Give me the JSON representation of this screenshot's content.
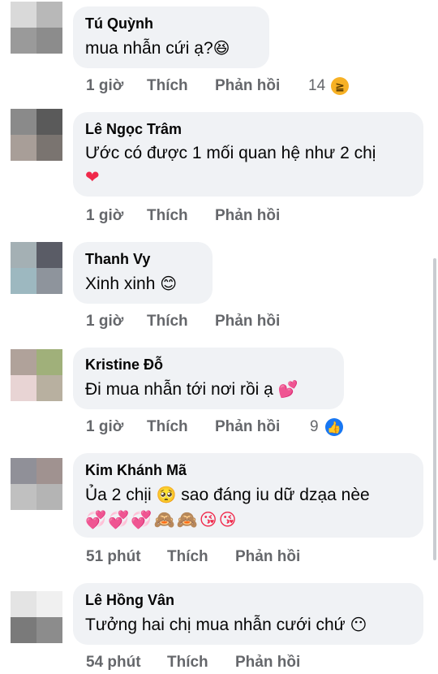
{
  "comments": [
    {
      "author": "Tú Quỳnh",
      "text": "mua nhẫn cứi ạ?",
      "emoji": "😆",
      "time": "1 giờ",
      "like": "Thích",
      "reply": "Phản hồi",
      "reaction_count": "14",
      "reaction_icon": "haha-icon",
      "avatar_colors": [
        "#d9d9d9",
        "#b8b8b8",
        "#9a9a9a",
        "#8c8c8c"
      ]
    },
    {
      "author": "Lê Ngọc Trâm",
      "text": "Ước có được 1 mối quan hệ như 2 chị",
      "emoji": "❤",
      "time": "1 giờ",
      "like": "Thích",
      "reply": "Phản hồi",
      "avatar_colors": [
        "#8a8a8a",
        "#5a5a5a",
        "#a89e98",
        "#7a7470"
      ]
    },
    {
      "author": "Thanh Vy",
      "text": "Xinh xinh",
      "emoji": "😊",
      "time": "1 giờ",
      "like": "Thích",
      "reply": "Phản hồi",
      "avatar_colors": [
        "#a4b0b4",
        "#5a5c66",
        "#9db8c0",
        "#8e949c"
      ]
    },
    {
      "author": "Kristine Đỗ",
      "text": "Đi mua nhẫn tới nơi rồi ạ",
      "emoji": "💕",
      "time": "1 giờ",
      "like": "Thích",
      "reply": "Phản hồi",
      "reaction_count": "9",
      "reaction_icon": "like-icon",
      "avatar_colors": [
        "#b0a29a",
        "#a0b07a",
        "#e8d4d4",
        "#b8b0a0"
      ]
    },
    {
      "author": "Kim Khánh Mã",
      "text": "Ủa 2 chịi",
      "text2": "sao đáng iu dữ dzạa nèe",
      "emoji": "🥺",
      "line2": "💞💞💞🙈🙈😘😘",
      "time": "51 phút",
      "like": "Thích",
      "reply": "Phản hồi",
      "avatar_colors": [
        "#909098",
        "#a09290",
        "#c0c0c0",
        "#b4b4b4"
      ]
    },
    {
      "author": "Lê Hồng Vân",
      "text": "Tưởng hai chị mua nhẫn cưới chứ",
      "emoji": "😶",
      "time": "54 phút",
      "like": "Thích",
      "reply": "Phản hồi",
      "avatar_colors": [
        "#e4e4e4",
        "#f0f0f0",
        "#7a7a7a",
        "#8c8c8c"
      ]
    }
  ]
}
